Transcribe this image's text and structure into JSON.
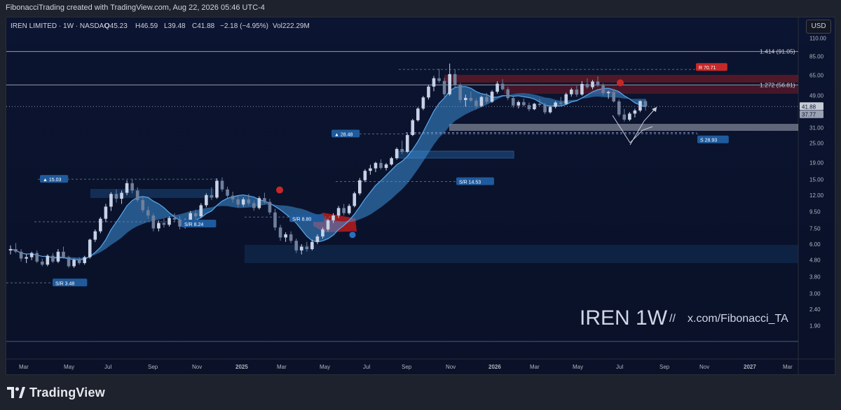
{
  "header": {
    "attribution": "FibonacciTrading created with TradingView.com, Aug 22, 2026 05:46 UTC-4"
  },
  "legend": {
    "symbol": "IREN LIMITED · 1W · NASDAQ",
    "open": "O45.23",
    "high": "H46.59",
    "low": "L39.48",
    "close": "C41.88",
    "change": "−2.18 (−4.95%)",
    "volume": "Vol222.29M"
  },
  "currency_button": "USD",
  "watermark": {
    "ticker": "IREN 1W",
    "separator": "//",
    "handle": "x.com/Fibonacci_TA"
  },
  "footer": {
    "brand": "TradingView"
  },
  "colors": {
    "background": "#0c1530",
    "up_candle": "#c8d2e6",
    "down_candle": "#6f7f9c",
    "cloud": "#3d8fd8",
    "resistance": "#c62828",
    "support_label": "#1f5a9c",
    "level_line": "#d1d4dc"
  },
  "chart_data": {
    "type": "candlestick",
    "y_scale": "log",
    "ylim": [
      1.6,
      140
    ],
    "y_ticks": [
      "110.00",
      "85.00",
      "65.00",
      "49.00",
      "37.77",
      "31.00",
      "25.00",
      "19.00",
      "15.00",
      "12.00",
      "9.50",
      "7.50",
      "6.00",
      "4.80",
      "3.80",
      "3.00",
      "2.40",
      "1.90"
    ],
    "x_ticks": [
      "Mar",
      "May",
      "Jul",
      "Sep",
      "Nov",
      "2025",
      "Mar",
      "May",
      "Jul",
      "Sep",
      "Nov",
      "2026",
      "Mar",
      "May",
      "Jul",
      "Sep",
      "Nov",
      "2027",
      "Mar"
    ],
    "last_price_label": "41.88",
    "fib_levels": [
      {
        "label": "1.414 (91.05)",
        "value": 91.05
      },
      {
        "label": "1.272 (56.81)",
        "value": 56.81
      }
    ],
    "resistance_label": "R  70.71",
    "support_label": "S  28.93",
    "sr_labels": [
      {
        "text": "▲ 15.03",
        "value": 15.03
      },
      {
        "text": "S/R  8.24",
        "value": 8.24
      },
      {
        "text": "S/R  8.80",
        "value": 8.8
      },
      {
        "text": "S/R  14.53",
        "value": 14.53
      },
      {
        "text": "▲ 28.48",
        "value": 28.48
      },
      {
        "text": "S/R  3.48",
        "value": 3.48
      }
    ],
    "candles_note": "weekly candles, Feb 2024 – Aug 2026 (approximate)",
    "candles": [
      [
        5.5,
        5.9,
        5.2,
        5.6
      ],
      [
        5.6,
        6.1,
        5.3,
        5.4
      ],
      [
        5.4,
        5.6,
        4.7,
        4.9
      ],
      [
        4.9,
        5.2,
        4.6,
        5.0
      ],
      [
        5.0,
        5.4,
        4.8,
        5.3
      ],
      [
        5.3,
        5.5,
        4.6,
        4.7
      ],
      [
        4.7,
        4.9,
        4.4,
        4.5
      ],
      [
        4.5,
        5.2,
        4.4,
        5.1
      ],
      [
        5.1,
        5.3,
        4.6,
        4.7
      ],
      [
        4.7,
        5.6,
        4.6,
        5.4
      ],
      [
        5.4,
        5.8,
        4.9,
        5.0
      ],
      [
        5.0,
        5.1,
        4.3,
        4.4
      ],
      [
        4.4,
        4.9,
        4.3,
        4.8
      ],
      [
        4.8,
        5.0,
        4.5,
        4.6
      ],
      [
        4.6,
        5.1,
        4.5,
        5.0
      ],
      [
        5.0,
        6.5,
        4.9,
        6.4
      ],
      [
        6.4,
        7.4,
        6.2,
        7.2
      ],
      [
        7.2,
        8.8,
        7.0,
        8.6
      ],
      [
        8.6,
        10.6,
        8.2,
        10.2
      ],
      [
        10.2,
        12.5,
        9.6,
        12.2
      ],
      [
        12.2,
        13.0,
        10.8,
        11.4
      ],
      [
        11.4,
        12.8,
        10.6,
        12.4
      ],
      [
        12.4,
        14.8,
        12.0,
        14.2
      ],
      [
        14.2,
        15.1,
        12.3,
        12.8
      ],
      [
        12.8,
        13.4,
        10.9,
        11.2
      ],
      [
        11.2,
        11.8,
        9.4,
        9.7
      ],
      [
        9.7,
        10.2,
        8.6,
        9.0
      ],
      [
        9.0,
        9.3,
        7.2,
        7.5
      ],
      [
        7.5,
        8.4,
        7.2,
        8.1
      ],
      [
        8.1,
        8.6,
        7.6,
        7.9
      ],
      [
        7.9,
        8.9,
        7.7,
        8.7
      ],
      [
        8.7,
        9.3,
        8.2,
        8.5
      ],
      [
        8.5,
        8.9,
        7.4,
        7.7
      ],
      [
        7.7,
        8.6,
        7.5,
        8.4
      ],
      [
        8.4,
        9.6,
        8.2,
        9.3
      ],
      [
        9.3,
        9.8,
        8.6,
        8.9
      ],
      [
        8.9,
        10.7,
        8.7,
        10.4
      ],
      [
        10.4,
        12.3,
        10.1,
        12.0
      ],
      [
        12.0,
        13.4,
        11.2,
        11.6
      ],
      [
        11.6,
        15.2,
        11.4,
        14.7
      ],
      [
        14.7,
        15.4,
        12.6,
        13.0
      ],
      [
        13.0,
        13.5,
        11.5,
        11.9
      ],
      [
        11.9,
        12.6,
        10.8,
        11.3
      ],
      [
        11.3,
        11.9,
        10.1,
        10.5
      ],
      [
        10.5,
        11.6,
        10.2,
        11.3
      ],
      [
        11.3,
        12.2,
        10.4,
        10.7
      ],
      [
        10.7,
        11.1,
        9.6,
        10.0
      ],
      [
        10.0,
        11.8,
        9.8,
        11.5
      ],
      [
        11.5,
        12.4,
        10.6,
        10.9
      ],
      [
        10.9,
        11.4,
        9.1,
        9.4
      ],
      [
        9.4,
        9.9,
        7.3,
        7.6
      ],
      [
        7.6,
        7.9,
        6.3,
        6.6
      ],
      [
        6.6,
        7.1,
        6.2,
        6.9
      ],
      [
        6.9,
        7.2,
        6.1,
        6.3
      ],
      [
        6.3,
        6.5,
        5.3,
        5.5
      ],
      [
        5.5,
        6.0,
        5.2,
        5.8
      ],
      [
        5.8,
        6.2,
        5.4,
        5.6
      ],
      [
        5.6,
        6.4,
        5.5,
        6.2
      ],
      [
        6.2,
        6.9,
        6.0,
        6.7
      ],
      [
        6.7,
        7.6,
        6.5,
        7.4
      ],
      [
        7.4,
        8.6,
        7.2,
        8.4
      ],
      [
        8.4,
        9.3,
        8.1,
        9.0
      ],
      [
        9.0,
        10.3,
        8.7,
        10.0
      ],
      [
        10.0,
        10.6,
        9.0,
        9.3
      ],
      [
        9.3,
        10.6,
        9.1,
        10.3
      ],
      [
        10.3,
        12.6,
        10.1,
        12.3
      ],
      [
        12.3,
        15.3,
        12.0,
        14.8
      ],
      [
        14.8,
        17.3,
        14.4,
        16.9
      ],
      [
        16.9,
        18.4,
        16.0,
        17.5
      ],
      [
        17.5,
        19.2,
        16.6,
        18.9
      ],
      [
        18.9,
        19.9,
        17.2,
        17.6
      ],
      [
        17.6,
        18.9,
        17.0,
        18.5
      ],
      [
        18.5,
        20.6,
        18.2,
        20.2
      ],
      [
        20.2,
        23.5,
        19.8,
        23.0
      ],
      [
        23.0,
        25.9,
        21.4,
        22.1
      ],
      [
        22.1,
        28.6,
        21.8,
        28.0
      ],
      [
        28.0,
        35.2,
        27.6,
        34.5
      ],
      [
        34.5,
        41.5,
        33.8,
        40.7
      ],
      [
        40.7,
        48.6,
        39.8,
        47.6
      ],
      [
        47.6,
        56.8,
        46.2,
        55.5
      ],
      [
        55.5,
        64.5,
        52.0,
        62.4
      ],
      [
        62.4,
        71.2,
        58.6,
        60.1
      ],
      [
        60.1,
        62.8,
        48.0,
        49.8
      ],
      [
        49.8,
        76.8,
        48.8,
        66.2
      ],
      [
        66.2,
        70.5,
        55.1,
        56.8
      ],
      [
        56.8,
        58.3,
        44.2,
        45.9
      ],
      [
        45.9,
        49.5,
        41.8,
        47.3
      ],
      [
        47.3,
        51.8,
        44.6,
        45.5
      ],
      [
        45.5,
        47.0,
        40.5,
        42.2
      ],
      [
        42.2,
        48.8,
        41.5,
        47.9
      ],
      [
        47.9,
        50.7,
        43.6,
        44.8
      ],
      [
        44.8,
        52.8,
        44.1,
        51.6
      ],
      [
        51.6,
        59.8,
        50.2,
        57.8
      ],
      [
        57.8,
        61.6,
        52.5,
        53.4
      ],
      [
        53.4,
        55.1,
        45.8,
        47.2
      ],
      [
        47.2,
        48.3,
        41.2,
        42.5
      ],
      [
        42.5,
        45.6,
        40.8,
        44.6
      ],
      [
        44.6,
        46.9,
        41.8,
        42.7
      ],
      [
        42.7,
        44.3,
        39.2,
        40.3
      ],
      [
        40.3,
        44.0,
        39.8,
        43.5
      ],
      [
        43.5,
        46.8,
        42.1,
        42.8
      ],
      [
        42.8,
        44.1,
        37.6,
        38.6
      ],
      [
        38.6,
        42.4,
        37.9,
        41.7
      ],
      [
        41.7,
        45.2,
        40.8,
        44.3
      ],
      [
        44.3,
        47.9,
        42.6,
        43.5
      ],
      [
        43.5,
        50.9,
        43.0,
        49.8
      ],
      [
        49.8,
        54.6,
        48.2,
        53.2
      ],
      [
        53.2,
        56.1,
        48.1,
        49.6
      ],
      [
        49.6,
        59.9,
        48.8,
        57.6
      ],
      [
        57.6,
        62.3,
        53.9,
        55.0
      ],
      [
        55.0,
        60.9,
        53.4,
        59.6
      ],
      [
        59.6,
        64.2,
        55.2,
        56.3
      ],
      [
        56.3,
        58.2,
        49.0,
        50.6
      ],
      [
        50.6,
        52.3,
        46.7,
        51.4
      ],
      [
        51.4,
        53.5,
        44.2,
        45.0
      ],
      [
        45.0,
        46.3,
        36.4,
        37.4
      ],
      [
        37.4,
        40.5,
        33.9,
        34.8
      ],
      [
        34.8,
        38.8,
        34.1,
        37.9
      ],
      [
        37.9,
        40.6,
        35.9,
        39.6
      ],
      [
        39.6,
        45.6,
        38.7,
        45.23
      ],
      [
        45.23,
        46.59,
        39.48,
        41.88
      ]
    ]
  }
}
